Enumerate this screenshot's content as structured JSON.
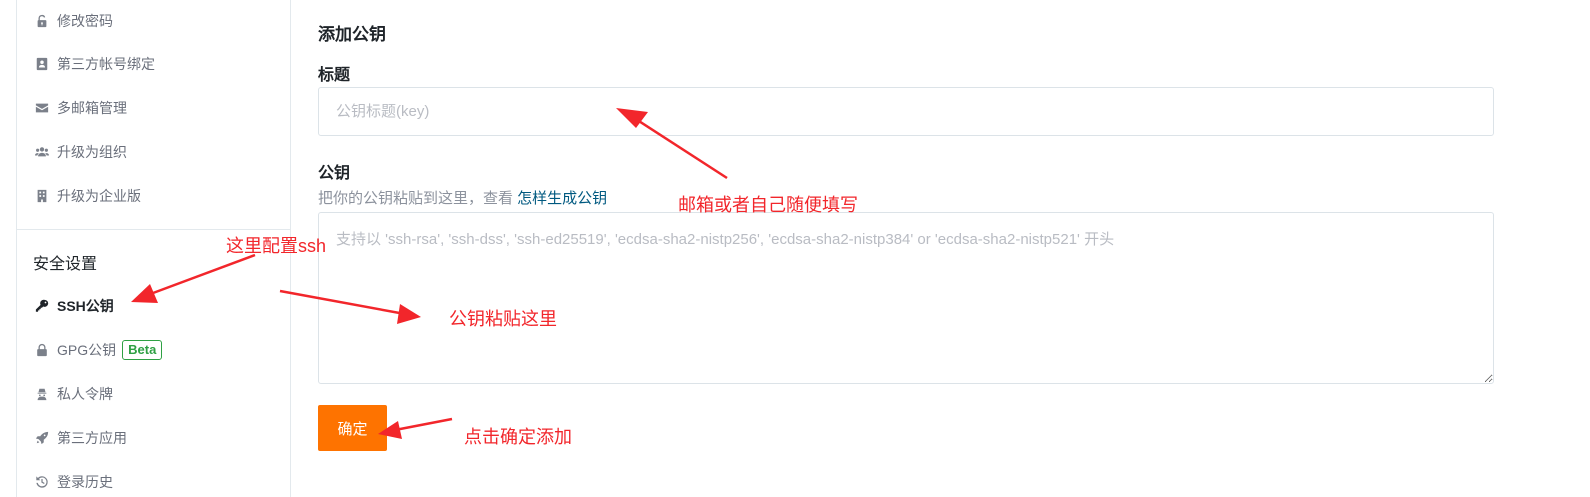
{
  "sidebar": {
    "items": [
      {
        "label": "修改密码",
        "icon": "unlock-icon"
      },
      {
        "label": "第三方帐号绑定",
        "icon": "id-card-icon"
      },
      {
        "label": "多邮箱管理",
        "icon": "envelope-icon"
      },
      {
        "label": "升级为组织",
        "icon": "users-icon"
      },
      {
        "label": "升级为企业版",
        "icon": "building-icon"
      }
    ],
    "section_title": "安全设置",
    "security_items": [
      {
        "label": "SSH公钥",
        "icon": "key-icon",
        "active": true
      },
      {
        "label": "GPG公钥",
        "icon": "lock-icon",
        "badge": "Beta"
      },
      {
        "label": "私人令牌",
        "icon": "user-secret-icon"
      },
      {
        "label": "第三方应用",
        "icon": "rocket-icon"
      },
      {
        "label": "登录历史",
        "icon": "history-icon"
      }
    ]
  },
  "form": {
    "title": "添加公钥",
    "title_label": "标题",
    "title_placeholder": "公钥标题(key)",
    "key_label": "公钥",
    "key_hint": "把你的公钥粘贴到这里，查看 ",
    "key_hint_link": "怎样生成公钥",
    "key_placeholder": "支持以 'ssh-rsa', 'ssh-dss', 'ssh-ed25519', 'ecdsa-sha2-nistp256', 'ecdsa-sha2-nistp384' or 'ecdsa-sha2-nistp521' 开头",
    "submit_label": "确定"
  },
  "annotations": {
    "config_ssh": "这里配置ssh",
    "email_hint": "邮箱或者自己随便填写",
    "paste_here": "公钥粘贴这里",
    "click_confirm": "点击确定添加",
    "color": "#f2262b"
  },
  "colors": {
    "accent": "#fe7300",
    "link": "#005980",
    "badge": "#2ea043"
  }
}
